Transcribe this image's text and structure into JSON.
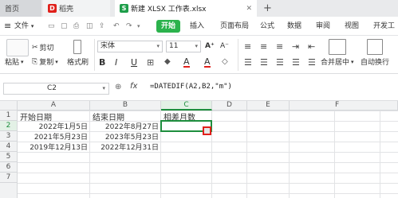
{
  "tabs": {
    "home": "首页",
    "daoke": "稻壳",
    "file": "新建 XLSX 工作表.xlsx",
    "new_tab": "+"
  },
  "menu": {
    "hamburger": "≡",
    "file": "文件",
    "start": "开始",
    "insert": "插入",
    "page_layout": "页面布局",
    "formula": "公式",
    "data": "数据",
    "review": "审阅",
    "view": "视图",
    "dev": "开发工"
  },
  "toolbar": {
    "cut": "剪切",
    "copy": "复制",
    "paste": "粘贴",
    "format_painter": "格式刷",
    "font_name": "宋体",
    "font_size": "11",
    "merge": "合并居中",
    "wrap": "自动换行",
    "bold": "B",
    "italic": "I",
    "underline": "U",
    "font_color_a": "A",
    "fill_color_a": "A"
  },
  "formula_bar": {
    "name_box": "C2",
    "fx": "fx",
    "formula": "=DATEDIF(A2,B2,\"m\")"
  },
  "columns": [
    "A",
    "B",
    "C",
    "D",
    "E",
    "F"
  ],
  "rows": [
    "1",
    "2",
    "3",
    "4",
    "5",
    "6",
    "7"
  ],
  "cells": {
    "A1": "开始日期",
    "B1": "结束日期",
    "C1": "相差月数",
    "A2": "2022年1月5日",
    "B2": "2022年8月27日",
    "A3": "2021年5月23日",
    "B3": "2023年5月23日",
    "A4": "2019年12月13日",
    "B4": "2022年12月31日"
  },
  "colors": {
    "accent": "#2bb24c",
    "selection": "#1e8e3e",
    "highlight": "#e0201b"
  }
}
